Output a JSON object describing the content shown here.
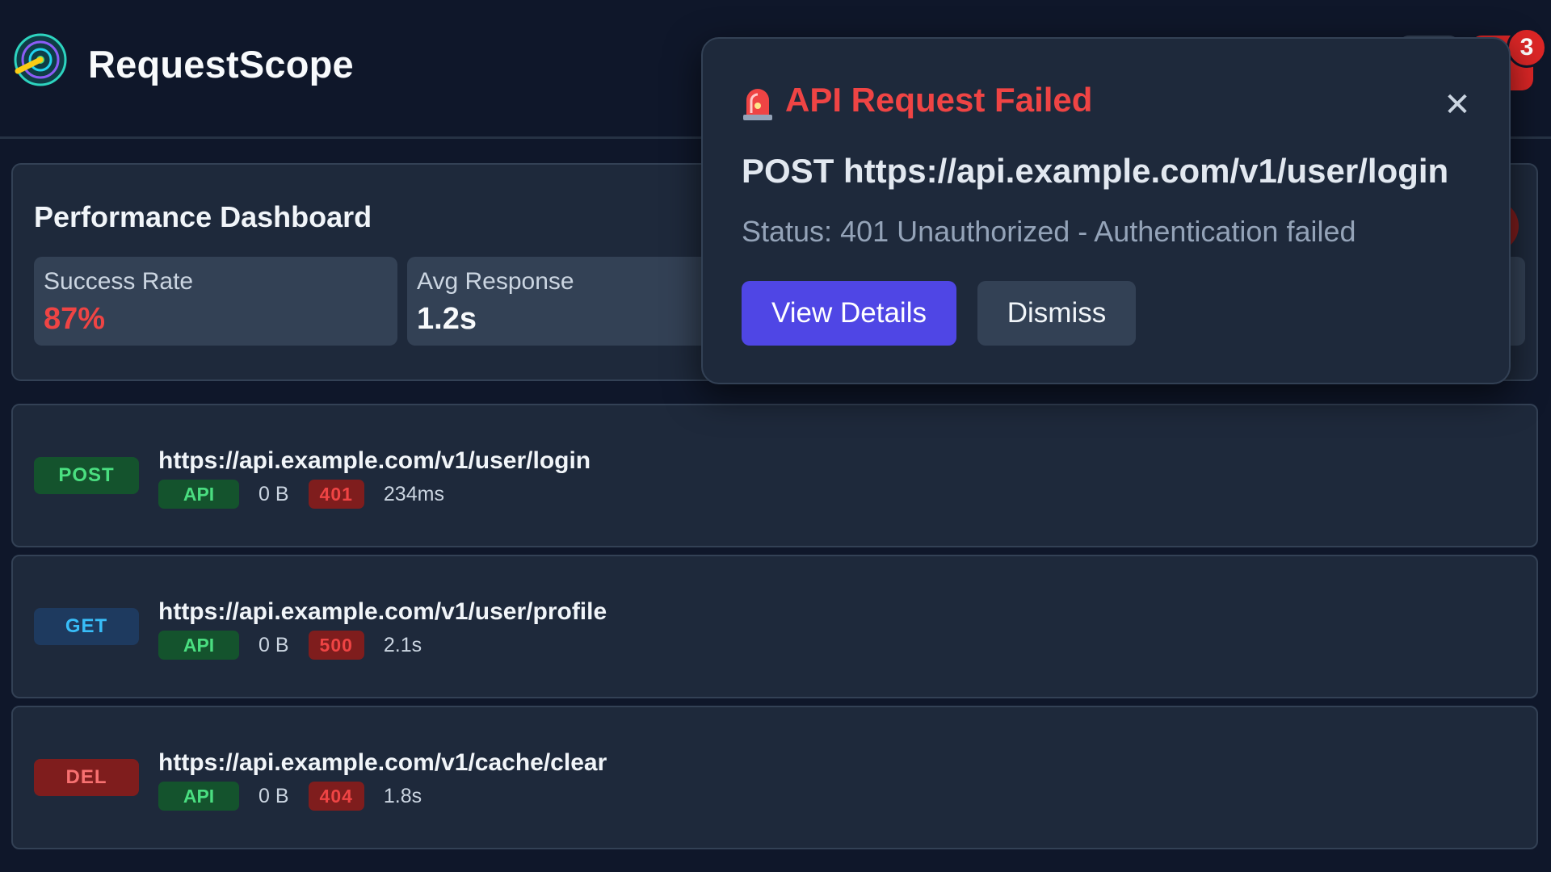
{
  "app": {
    "title": "RequestScope",
    "notification_count": "3"
  },
  "dashboard": {
    "title": "Performance Dashboard",
    "stats": [
      {
        "label": "Success Rate",
        "value": "87%"
      },
      {
        "label": "Avg Response",
        "value": "1.2s"
      }
    ]
  },
  "requests": [
    {
      "method": "POST",
      "url": "https://api.example.com/v1/user/login",
      "type": "API",
      "size": "0 B",
      "status": "401",
      "time": "234ms"
    },
    {
      "method": "GET",
      "url": "https://api.example.com/v1/user/profile",
      "type": "API",
      "size": "0 B",
      "status": "500",
      "time": "2.1s"
    },
    {
      "method": "DEL",
      "url": "https://api.example.com/v1/cache/clear",
      "type": "API",
      "size": "0 B",
      "status": "404",
      "time": "1.8s"
    }
  ],
  "toast": {
    "icon": "siren-icon",
    "title": "API Request Failed",
    "request": "POST https://api.example.com/v1/user/login",
    "status": "Status: 401 Unauthorized - Authentication failed",
    "primary_label": "View Details",
    "secondary_label": "Dismiss",
    "close_glyph": "✕"
  },
  "colors": {
    "background": "#0f172a",
    "surface": "#1e293b",
    "error": "#ef4444",
    "primary": "#4f46e5",
    "success": "#4ade80"
  }
}
